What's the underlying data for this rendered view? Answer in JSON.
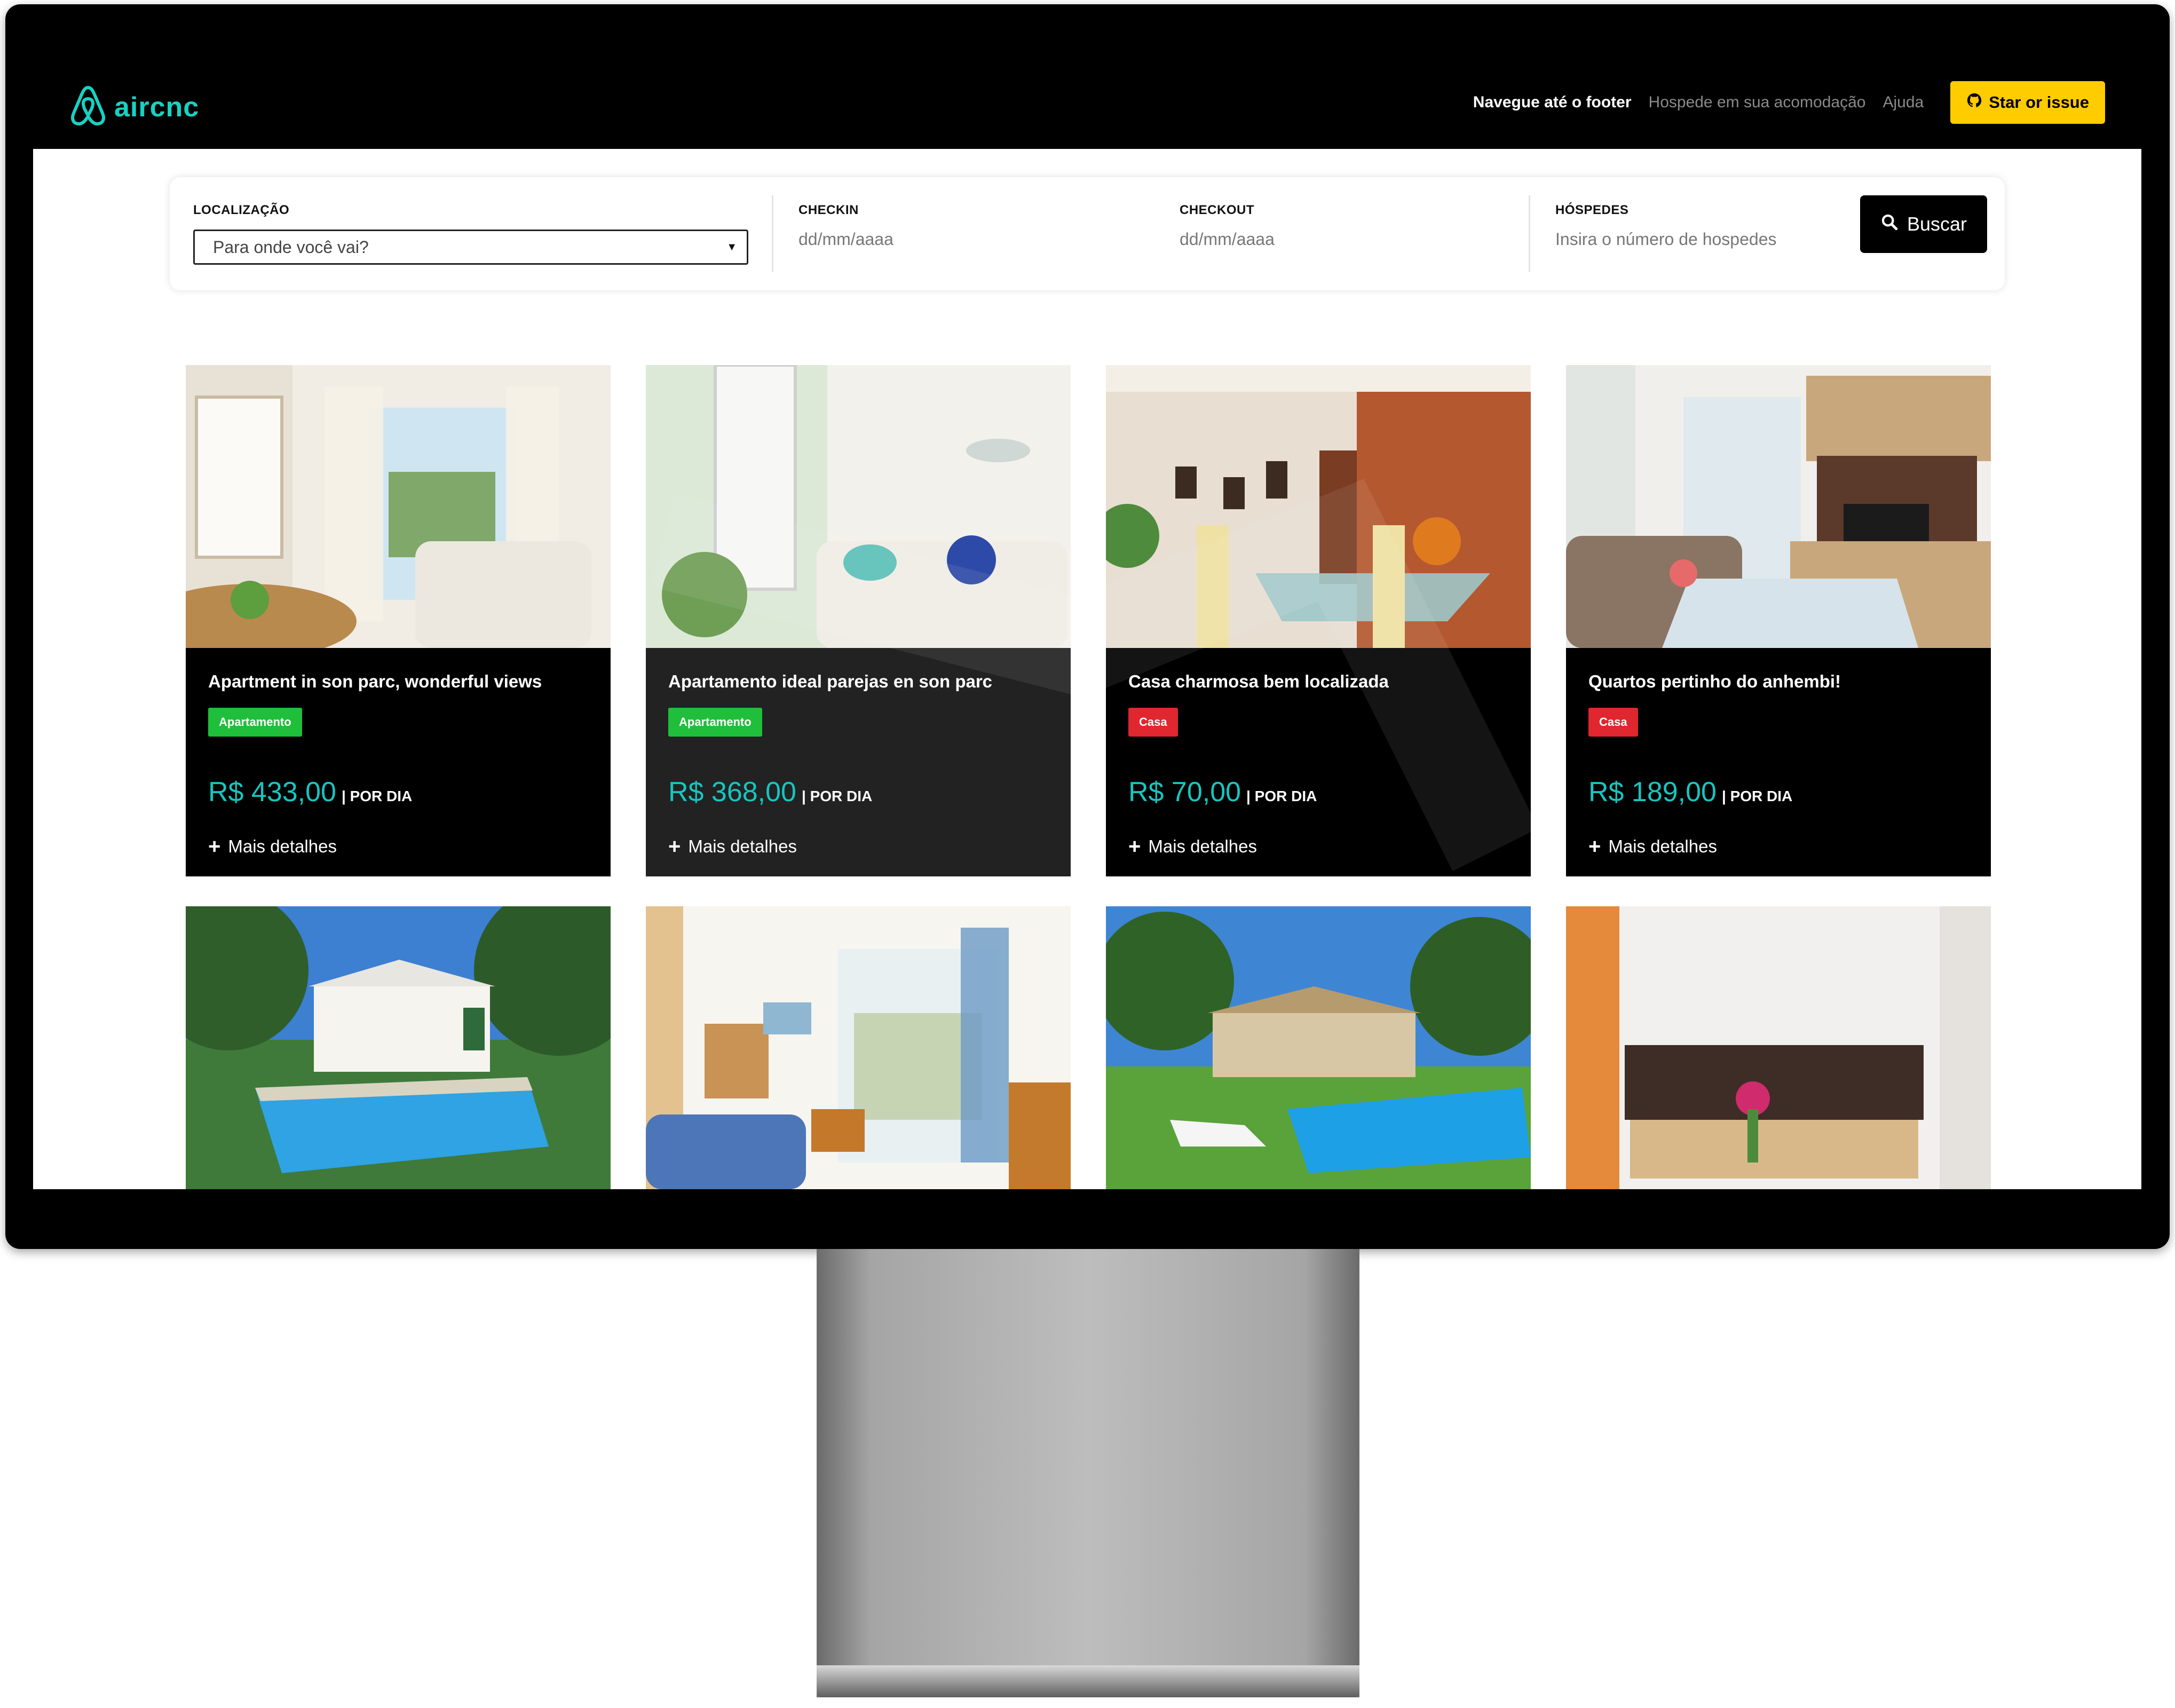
{
  "brand": {
    "name": "aircnc",
    "accent": "#17d2c3"
  },
  "nav": {
    "footer_link": "Navegue até o footer",
    "host_link": "Hospede em sua acomodação",
    "help_link": "Ajuda",
    "star_button": "Star or issue",
    "star_icon": "github-icon"
  },
  "search": {
    "location_label": "LOCALIZAÇÃO",
    "location_value": "Para onde você vai?",
    "checkin_label": "CHECKIN",
    "checkin_placeholder": "dd/mm/aaaa",
    "checkout_label": "CHECKOUT",
    "checkout_placeholder": "dd/mm/aaaa",
    "guests_label": "HÓSPEDES",
    "guests_placeholder": "Insira o número de hospedes",
    "search_button": "Buscar"
  },
  "listings": [
    {
      "title": "Apartment in son parc, wonderful views",
      "type": "Apartamento",
      "type_color": "#1fbf3b",
      "price": "R$ 433,00",
      "unit": "| POR DIA",
      "details": "Mais detalhes"
    },
    {
      "title": "Apartamento ideal parejas en son parc",
      "type": "Apartamento",
      "type_color": "#1fbf3b",
      "price": "R$ 368,00",
      "unit": "| POR DIA",
      "details": "Mais detalhes"
    },
    {
      "title": "Casa charmosa bem localizada",
      "type": "Casa",
      "type_color": "#e0262f",
      "price": "R$ 70,00",
      "unit": "| POR DIA",
      "details": "Mais detalhes"
    },
    {
      "title": "Quartos pertinho do anhembi!",
      "type": "Casa",
      "type_color": "#e0262f",
      "price": "R$ 189,00",
      "unit": "| POR DIA",
      "details": "Mais detalhes"
    }
  ],
  "colors": {
    "price": "#16c6c0",
    "star_button": "#ffcc00",
    "apartamento": "#1fbf3b",
    "casa": "#e0262f"
  }
}
